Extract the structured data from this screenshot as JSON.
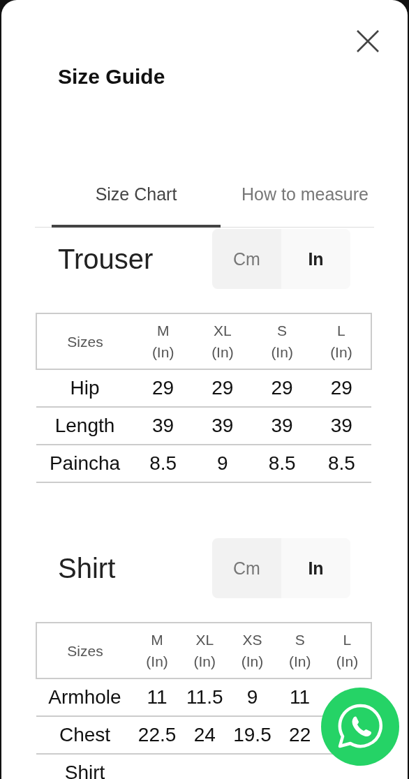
{
  "dialog": {
    "title": "Size Guide"
  },
  "tabs": [
    {
      "label": "Size Chart",
      "selected": true
    },
    {
      "label": "How to measure",
      "selected": false
    }
  ],
  "sections": [
    {
      "title": "Trouser",
      "units": [
        {
          "label": "Cm",
          "selected": false
        },
        {
          "label": "In",
          "selected": true
        }
      ],
      "table": {
        "first_column": "Sizes",
        "columns": [
          {
            "size": "M",
            "unit": "(In)"
          },
          {
            "size": "XL",
            "unit": "(In)"
          },
          {
            "size": "S",
            "unit": "(In)"
          },
          {
            "size": "L",
            "unit": "(In)"
          }
        ],
        "rows": [
          {
            "label": "Hip",
            "cells": [
              "29",
              "29",
              "29",
              "29"
            ]
          },
          {
            "label": "Length",
            "cells": [
              "39",
              "39",
              "39",
              "39"
            ]
          },
          {
            "label": "Paincha",
            "cells": [
              "8.5",
              "9",
              "8.5",
              "8.5"
            ]
          }
        ]
      }
    },
    {
      "title": "Shirt",
      "units": [
        {
          "label": "Cm",
          "selected": false
        },
        {
          "label": "In",
          "selected": true
        }
      ],
      "table": {
        "first_column": "Sizes",
        "columns": [
          {
            "size": "M",
            "unit": "(In)"
          },
          {
            "size": "XL",
            "unit": "(In)"
          },
          {
            "size": "XS",
            "unit": "(In)"
          },
          {
            "size": "S",
            "unit": "(In)"
          },
          {
            "size": "L",
            "unit": "(In)"
          }
        ],
        "rows": [
          {
            "label": "Armhole",
            "cells": [
              "11",
              "11.5",
              "9",
              "11"
            ]
          },
          {
            "label": "Chest",
            "cells": [
              "22.5",
              "24",
              "19.5",
              "22"
            ]
          },
          {
            "label": "Shirt",
            "cells": []
          }
        ]
      }
    }
  ]
}
